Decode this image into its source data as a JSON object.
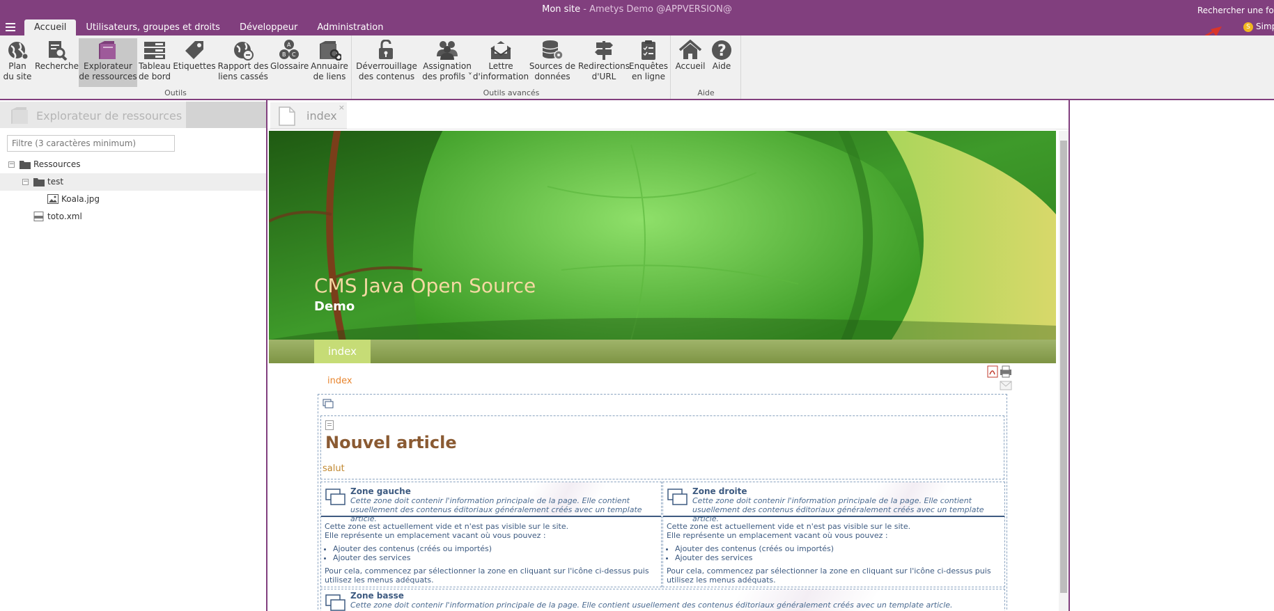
{
  "app": {
    "title": "Mon site",
    "subtitle": " - Ametys Demo @APPVERSION@",
    "search_placeholder": "Rechercher une fonctionnalité",
    "user_initial": "S",
    "user_name": "Simple User"
  },
  "menu_tabs": [
    {
      "label": "Accueil",
      "active": true
    },
    {
      "label": "Utilisateurs, groupes et droits"
    },
    {
      "label": "Développeur"
    },
    {
      "label": "Administration"
    }
  ],
  "ribbon": {
    "groups": [
      {
        "label": "Outils"
      },
      {
        "label": "Outils avancés"
      },
      {
        "label": "Aide"
      }
    ],
    "buttons": [
      {
        "label": "Plan\ndu site",
        "icon": "globe-icon"
      },
      {
        "label": "Recherche",
        "icon": "search-doc-icon"
      },
      {
        "label": "Explorateur\nde ressources",
        "icon": "folder-icon",
        "active": true
      },
      {
        "label": "Tableau\nde bord",
        "icon": "dashboard-icon"
      },
      {
        "label": "Etiquettes",
        "icon": "tag-icon"
      },
      {
        "label": "Rapport des\nliens cassés",
        "icon": "broken-link-icon"
      },
      {
        "label": "Glossaire",
        "icon": "glossary-icon"
      },
      {
        "label": "Annuaire\nde liens",
        "icon": "link-directory-icon"
      },
      {
        "label": "Déverrouillage\ndes contenus",
        "icon": "unlock-icon"
      },
      {
        "label": "Assignation\ndes profils ˅",
        "icon": "users-icon"
      },
      {
        "label": "Lettre\nd'information",
        "icon": "newsletter-icon"
      },
      {
        "label": "Sources de\ndonnées",
        "icon": "database-icon"
      },
      {
        "label": "Redirections\nd'URL",
        "icon": "signpost-icon"
      },
      {
        "label": "Enquêtes\nen ligne",
        "icon": "survey-icon"
      },
      {
        "label": "Accueil",
        "icon": "home-icon"
      },
      {
        "label": "Aide",
        "icon": "help-icon"
      }
    ]
  },
  "explorer": {
    "title": "Explorateur de ressources",
    "filter_placeholder": "Filtre (3 caractères minimum)",
    "tree": [
      {
        "label": "Ressources",
        "type": "folder"
      },
      {
        "label": "test",
        "type": "folder"
      },
      {
        "label": "Koala.jpg",
        "type": "image"
      },
      {
        "label": "toto.xml",
        "type": "xml"
      }
    ]
  },
  "editor": {
    "tab_label": "index",
    "close": "×",
    "banner_title": "CMS Java Open Source",
    "banner_subtitle": "Demo",
    "nav_tab": "index",
    "breadcrumb": "index",
    "article_title": "Nouvel article",
    "article_text": "salut",
    "zones": [
      {
        "title": "Zone gauche",
        "desc": "Cette zone doit contenir l'information principale de la page. Elle contient usuellement des contenus éditoriaux généralement créés avec un template article.",
        "line1": "Cette zone est actuellement vide et n'est pas visible sur le site.",
        "line2": "Elle représente un emplacement vacant où vous pouvez :",
        "bullet1": "Ajouter des contenus (créés ou importés)",
        "bullet2": "Ajouter des services",
        "footer": "Pour cela, commencez par sélectionner la zone en cliquant sur l'icône ci-dessus puis utilisez les menus adéquats."
      },
      {
        "title": "Zone droite",
        "desc": "Cette zone doit contenir l'information principale de la page. Elle contient usuellement des contenus éditoriaux généralement créés avec un template article.",
        "line1": "Cette zone est actuellement vide et n'est pas visible sur le site.",
        "line2": "Elle représente un emplacement vacant où vous pouvez :",
        "bullet1": "Ajouter des contenus (créés ou importés)",
        "bullet2": "Ajouter des services",
        "footer": "Pour cela, commencez par sélectionner la zone en cliquant sur l'icône ci-dessus puis utilisez les menus adéquats."
      },
      {
        "title": "Zone basse",
        "desc": "Cette zone doit contenir l'information principale de la page. Elle contient usuellement des contenus éditoriaux généralement créés avec un template article."
      }
    ]
  },
  "colors": {
    "brand": "#813f7e",
    "accent_orange": "#e8852e",
    "article_title": "#8a5a32",
    "zone_blue": "#3d5a80"
  }
}
